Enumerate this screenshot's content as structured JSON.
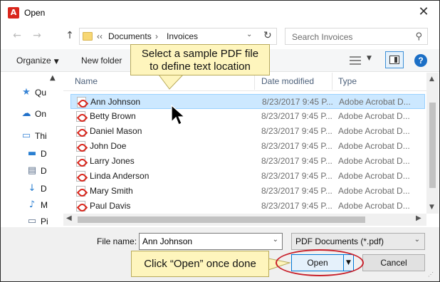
{
  "window": {
    "title": "Open",
    "close_glyph": "✕"
  },
  "nav": {
    "back_glyph": "←",
    "forward_glyph": "→",
    "up_glyph": "↑",
    "breadcrumb": {
      "overflow": "‹‹",
      "items": [
        "Documents",
        "Invoices"
      ],
      "separator": "›"
    },
    "dropdown_glyph": "⌄",
    "refresh_glyph": "↻",
    "search_placeholder": "Search Invoices",
    "search_glyph": "⚲"
  },
  "toolbar": {
    "organize": "Organize",
    "new_folder": "New folder",
    "caret": "▼",
    "help": "?"
  },
  "sidebar": {
    "items": [
      {
        "icon": "star-icon",
        "glyph": "★",
        "label": "Qu",
        "color": "#3a86d6"
      },
      {
        "icon": "cloud-icon",
        "glyph": "☁",
        "label": "On",
        "color": "#1f6fc9"
      },
      {
        "icon": "computer-icon",
        "glyph": "▭",
        "label": "Thi",
        "color": "#3a86d6"
      },
      {
        "icon": "desktop-icon",
        "glyph": "▬",
        "label": "D",
        "color": "#2a7fd1"
      },
      {
        "icon": "document-icon",
        "glyph": "▤",
        "label": "D",
        "color": "#5a6e8a"
      },
      {
        "icon": "download-icon",
        "glyph": "↓",
        "label": "D",
        "color": "#2a7fd1"
      },
      {
        "icon": "music-icon",
        "glyph": "♪",
        "label": "M",
        "color": "#2a7fd1"
      },
      {
        "icon": "pictures-icon",
        "glyph": "▭",
        "label": "Pi",
        "color": "#5a6e8a"
      }
    ],
    "scroll_up": "▲",
    "scroll_down": "▼"
  },
  "columns": {
    "name": "Name",
    "date": "Date modified",
    "type": "Type",
    "sort_glyph": "^"
  },
  "files": [
    {
      "name": "Ann Johnson",
      "date": "8/23/2017 9:45 P...",
      "type": "Adobe Acrobat D...",
      "selected": true
    },
    {
      "name": "Betty Brown",
      "date": "8/23/2017 9:45 P...",
      "type": "Adobe Acrobat D...",
      "selected": false
    },
    {
      "name": "Daniel Mason",
      "date": "8/23/2017 9:45 P...",
      "type": "Adobe Acrobat D...",
      "selected": false
    },
    {
      "name": "John Doe",
      "date": "8/23/2017 9:45 P...",
      "type": "Adobe Acrobat D...",
      "selected": false
    },
    {
      "name": "Larry Jones",
      "date": "8/23/2017 9:45 P...",
      "type": "Adobe Acrobat D...",
      "selected": false
    },
    {
      "name": "Linda Anderson",
      "date": "8/23/2017 9:45 P...",
      "type": "Adobe Acrobat D...",
      "selected": false
    },
    {
      "name": "Mary Smith",
      "date": "8/23/2017 9:45 P...",
      "type": "Adobe Acrobat D...",
      "selected": false
    },
    {
      "name": "Paul Davis",
      "date": "8/23/2017 9:45 P...",
      "type": "Adobe Acrobat D...",
      "selected": false
    }
  ],
  "scroll": {
    "up": "▲",
    "down": "▼",
    "left": "◀",
    "right": "▶"
  },
  "bottom": {
    "file_name_label": "File name:",
    "file_name_value": "Ann Johnson",
    "file_type_value": "PDF Documents (*.pdf)",
    "dropdown_glyph": "⌄",
    "open_label": "Open",
    "open_split_glyph": "▼",
    "cancel_label": "Cancel",
    "grip": "⋰"
  },
  "annotations": {
    "callout_top_line1": "Select a sample PDF file",
    "callout_top_line2": "to define text location",
    "callout_bottom": "Click “Open” once done"
  },
  "colors": {
    "selection": "#cce8ff",
    "callout_bg": "#fef5bd",
    "highlight_ring": "#c8202a",
    "accent": "#0078d7"
  }
}
